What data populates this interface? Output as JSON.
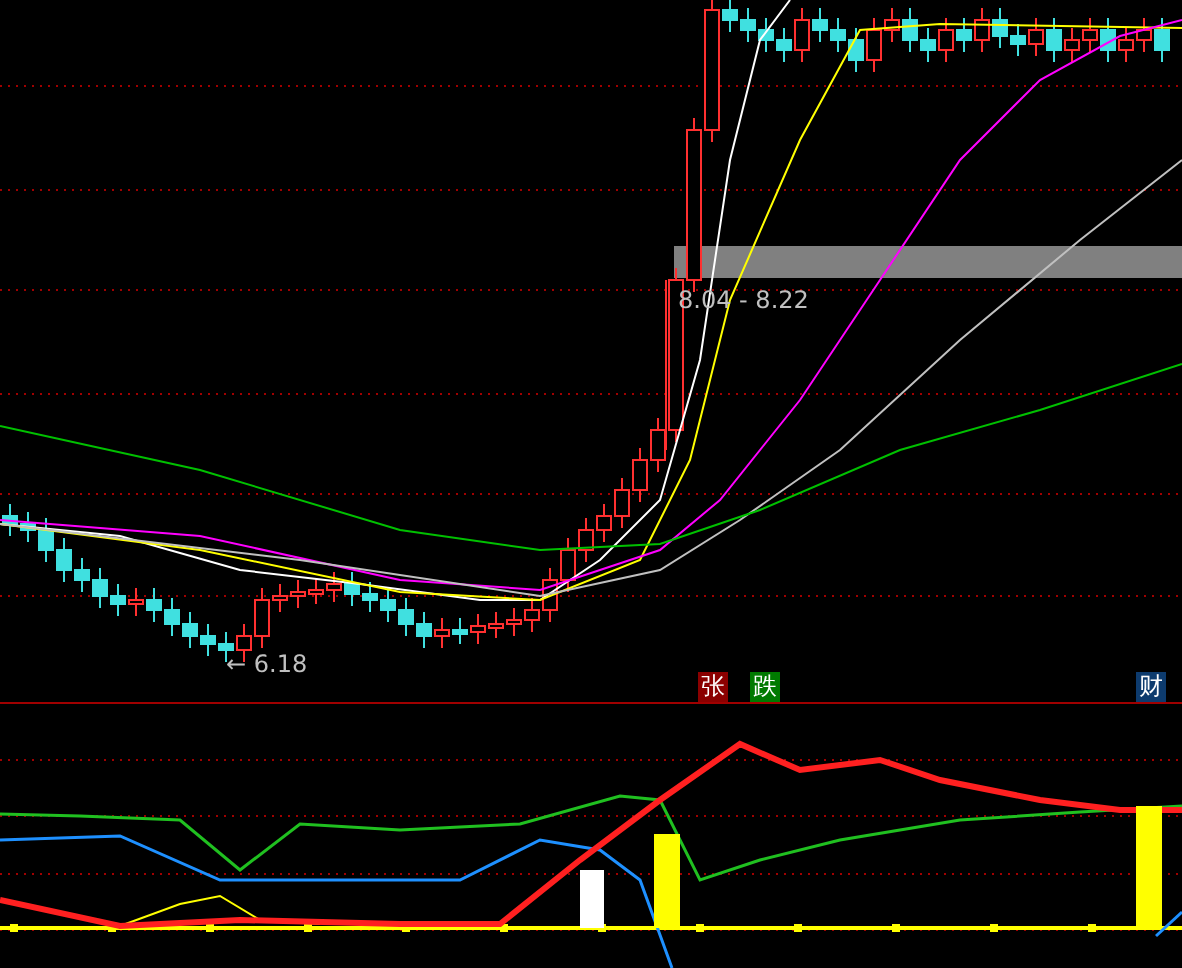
{
  "price_chart": {
    "range_label": "8.04 - 8.22",
    "low_label": "← 6.18"
  },
  "signal_badges": [
    {
      "text": "张",
      "color": "#8b0000"
    },
    {
      "text": "跌",
      "color": "#007a00"
    },
    {
      "text": "财",
      "color": "#0d3b6e"
    }
  ]
}
